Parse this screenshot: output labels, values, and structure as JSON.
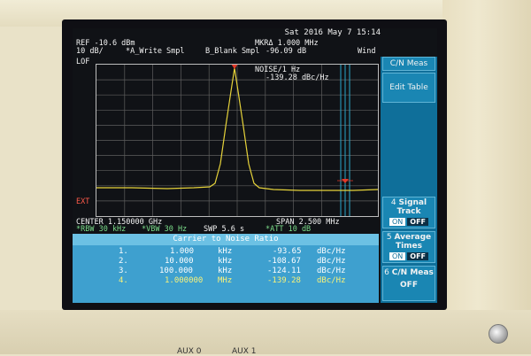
{
  "header": {
    "datetime": "Sat 2016 May  7 15:14",
    "ref": "REF -10.6 dBm",
    "scale": "10 dB/",
    "trace_a": "*A_Write Smpl",
    "trace_b": "B_Blank Smpl",
    "mkr": "MKRΔ 1.000 MHz",
    "mkr_value": "-96.09 dB",
    "wind": "Wind",
    "lof": "LOF",
    "ext": "EXT",
    "noise": "NOISE/1 Hz",
    "noise_value": "-139.28 dBc/Hz"
  },
  "footer": {
    "center": "CENTER 1.150000 GHz",
    "span": "SPAN 2.500 MHz",
    "rbw": "*RBW 30 kHz",
    "vbw": "*VBW 30 Hz",
    "swp": "SWP 5.6 s",
    "att": "*ATT 10 dB"
  },
  "softkeys": {
    "header": "C/N Meas",
    "edit_table": "Edit Table",
    "signal_track": {
      "num": "4",
      "label_1": "Signal",
      "label_2": "Track",
      "on": "ON",
      "off": "OFF"
    },
    "average": {
      "num": "5",
      "label_1": "Average",
      "label_2": "Times",
      "on": "ON",
      "off": "OFF"
    },
    "cn_meas": {
      "num": "6",
      "label_1": "C/N Meas",
      "label_2": "OFF"
    }
  },
  "table": {
    "title": "Carrier to Noise Ratio",
    "rows": [
      {
        "n": "1.",
        "freq": "1.000",
        "unit": "kHz",
        "val": "-93.65",
        "vunit": "dBc/Hz"
      },
      {
        "n": "2.",
        "freq": "10.000",
        "unit": "kHz",
        "val": "-108.67",
        "vunit": "dBc/Hz"
      },
      {
        "n": "3.",
        "freq": "100.000",
        "unit": "kHz",
        "val": "-124.11",
        "vunit": "dBc/Hz"
      },
      {
        "n": "4.",
        "freq": "1.000000",
        "unit": "MHz",
        "val": "-139.28",
        "vunit": "dBc/Hz"
      }
    ]
  },
  "ports": {
    "aux0": "AUX 0",
    "aux1": "AUX 1"
  },
  "colors": {
    "trace": "#e5d23a",
    "marker": "#e23a2a",
    "softkey_bg": "#1a86b3",
    "table_bg": "#3ea0cf"
  }
}
